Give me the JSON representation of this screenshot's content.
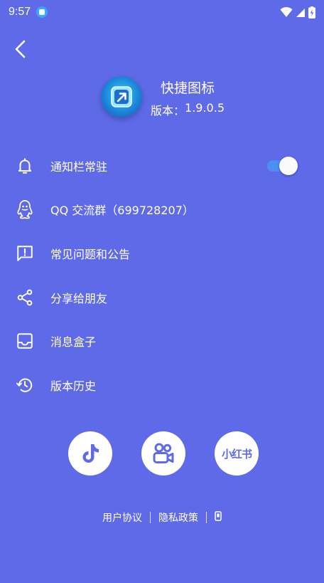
{
  "status_bar": {
    "time": "9:57",
    "app_icon": "app-notification-icon",
    "icons": [
      "wifi-icon",
      "signal-icon",
      "battery-charging-icon"
    ]
  },
  "header": {
    "back_icon": "chevron-left-icon",
    "app_name": "快捷图标",
    "version_label": "版本：",
    "version_number": "1.9.0.5"
  },
  "menu": {
    "items": [
      {
        "label": "通知栏常驻",
        "icon": "bell-icon",
        "toggle": true
      },
      {
        "label": "QQ 交流群（699728207）",
        "icon": "qq-penguin-icon"
      },
      {
        "label": "常见问题和公告",
        "icon": "message-alert-icon"
      },
      {
        "label": "分享给朋友",
        "icon": "share-icon"
      },
      {
        "label": "消息盒子",
        "icon": "inbox-icon"
      },
      {
        "label": "版本历史",
        "icon": "history-icon"
      }
    ]
  },
  "social": [
    {
      "name": "douyin-icon"
    },
    {
      "name": "kuaishou-icon"
    },
    {
      "name": "xiaohongshu-icon",
      "text": "小红书"
    }
  ],
  "footer": {
    "user_agreement": "用户协议",
    "privacy_policy": "隐私政策",
    "icp_icon": "phone-icon"
  },
  "colors": {
    "background": "#5f6ae8",
    "toggle_on": "#4b8ef4",
    "white": "#ffffff"
  }
}
